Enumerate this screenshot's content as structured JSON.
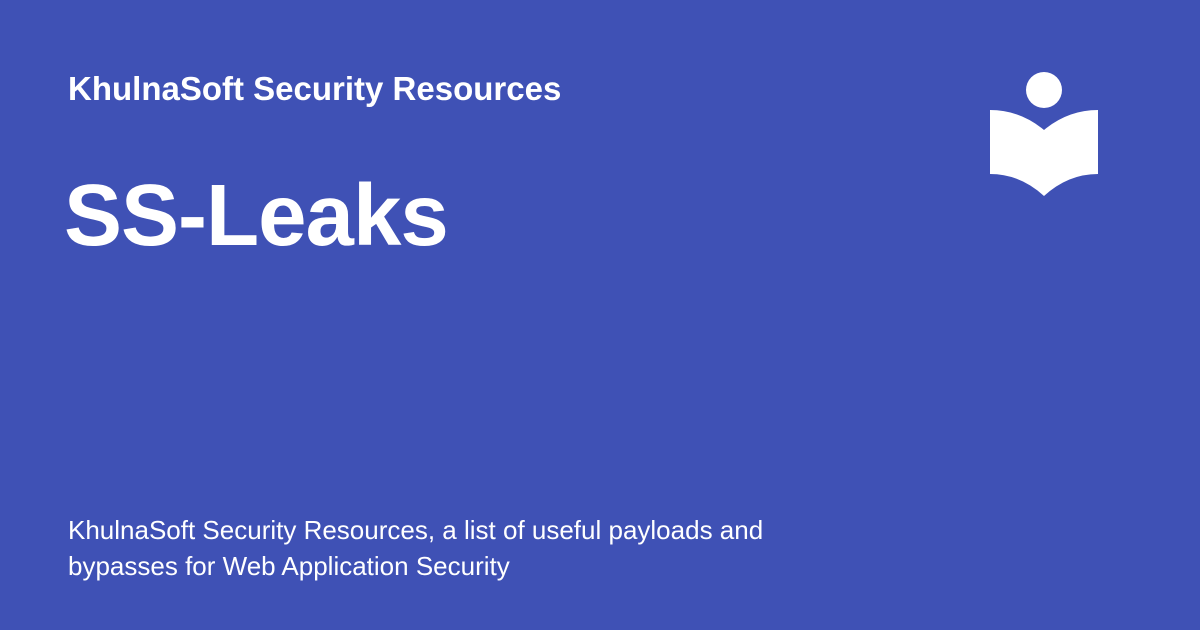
{
  "card": {
    "site_name": "KhulnaSoft Security Resources",
    "page_title": "SS-Leaks",
    "description": "KhulnaSoft Security Resources, a list of useful payloads and bypasses for Web Application Security",
    "logo_icon": "reader-book-icon",
    "background_color": "#3f51b5",
    "text_color": "#ffffff"
  }
}
